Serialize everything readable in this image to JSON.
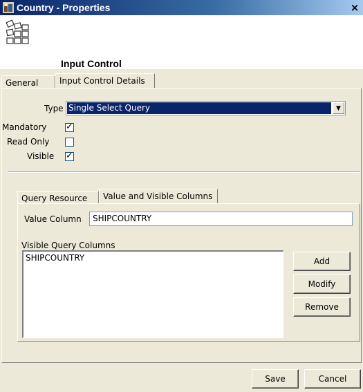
{
  "window": {
    "title": "Country - Properties",
    "close_glyph": "×"
  },
  "header": {
    "title": "Input Control",
    "icon": "input-control-icon"
  },
  "main_tabs": [
    {
      "label": "General",
      "active": false
    },
    {
      "label": "Input Control Details",
      "active": true
    }
  ],
  "form": {
    "type_label": "Type",
    "type_value": "Single Select Query",
    "mandatory_label": "Mandatory",
    "mandatory_checked": true,
    "read_only_label": "Read Only",
    "read_only_checked": false,
    "visible_label": "Visible",
    "visible_checked": true,
    "check_glyph": "✓"
  },
  "sub_tabs": [
    {
      "label": "Query Resource",
      "active": false
    },
    {
      "label": "Value and Visible Columns",
      "active": true
    }
  ],
  "columns": {
    "value_column_label": "Value Column",
    "value_column_value": "SHIPCOUNTRY",
    "visible_columns_label": "Visible Query Columns",
    "visible_columns_items": [
      "SHIPCOUNTRY"
    ],
    "add_label": "Add",
    "modify_label": "Modify",
    "remove_label": "Remove"
  },
  "footer": {
    "save_label": "Save",
    "cancel_label": "Cancel"
  }
}
